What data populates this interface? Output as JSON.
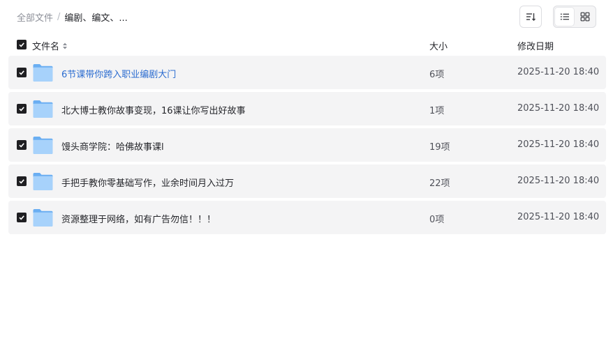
{
  "breadcrumb": {
    "root": "全部文件",
    "separator": "/",
    "current": "编剧、编文、..."
  },
  "toolbar": {
    "sort_icon": "sort-icon",
    "list_view_icon": "list-view-icon",
    "grid_view_icon": "grid-view-icon",
    "active_view": "list"
  },
  "table": {
    "headers": {
      "name": "文件名",
      "size": "大小",
      "modified": "修改日期"
    },
    "rows": [
      {
        "name": "6节课带你跨入职业编剧大门",
        "size": "6项",
        "modified": "2025-11-20 18:40",
        "checked": true,
        "highlighted": true
      },
      {
        "name": "北大博士教你故事变现，16课让你写出好故事",
        "size": "1项",
        "modified": "2025-11-20 18:40",
        "checked": true,
        "highlighted": false
      },
      {
        "name": "馒头商学院：哈佛故事课l",
        "size": "19项",
        "modified": "2025-11-20 18:40",
        "checked": true,
        "highlighted": false
      },
      {
        "name": "手把手教你零基础写作，业余时间月入过万",
        "size": "22项",
        "modified": "2025-11-20 18:40",
        "checked": true,
        "highlighted": false
      },
      {
        "name": "资源整理于网络，如有广告勿信！！！",
        "size": "0项",
        "modified": "2025-11-20 18:40",
        "checked": true,
        "highlighted": false
      }
    ]
  },
  "colors": {
    "link": "#2b6cd0",
    "row_bg": "#f4f4f5",
    "checkbox": "#1f1f22",
    "folder": "#7cb8f5"
  }
}
